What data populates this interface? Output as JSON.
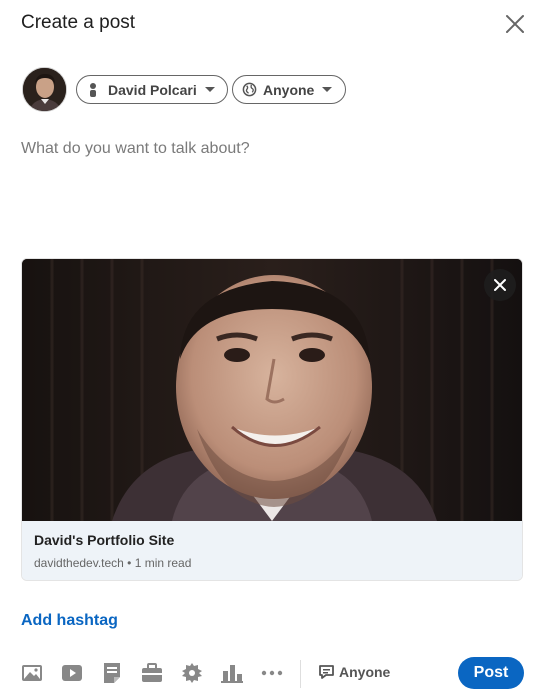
{
  "dialog": {
    "title": "Create a post"
  },
  "author": {
    "name": "David Polcari"
  },
  "audience": {
    "label": "Anyone"
  },
  "editor": {
    "placeholder": "What do you want to talk about?"
  },
  "link_preview": {
    "title": "David's Portfolio Site",
    "subtitle": "davidthedev.tech • 1 min read"
  },
  "hashtag": {
    "label": "Add hashtag"
  },
  "toolbar": {
    "comment_audience": "Anyone",
    "post_label": "Post",
    "icons": [
      "photo-icon",
      "video-icon",
      "document-icon",
      "briefcase-icon",
      "celebrate-icon",
      "poll-icon",
      "more-icon"
    ]
  },
  "colors": {
    "accent": "#0a66c2",
    "card_meta_bg": "#eef3f8",
    "muted_text": "#666666"
  }
}
